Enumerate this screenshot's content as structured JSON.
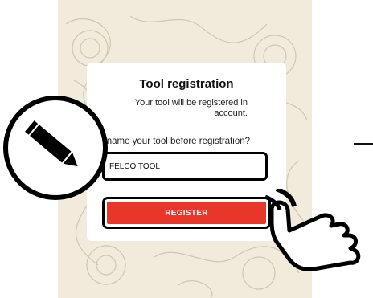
{
  "dialog": {
    "title": "Tool registration",
    "subtitle": "Your tool will be registered in account.",
    "rename_label": "Rename your tool before registration?",
    "tool_name_value": "FELCO TOOL",
    "register_label": "REGISTER"
  },
  "colors": {
    "background_pattern": "#f2ebdc",
    "register_button": "#e8362a",
    "outline": "#000000"
  },
  "icons": {
    "pencil": "pencil-icon",
    "hand": "pointing-hand-icon"
  }
}
